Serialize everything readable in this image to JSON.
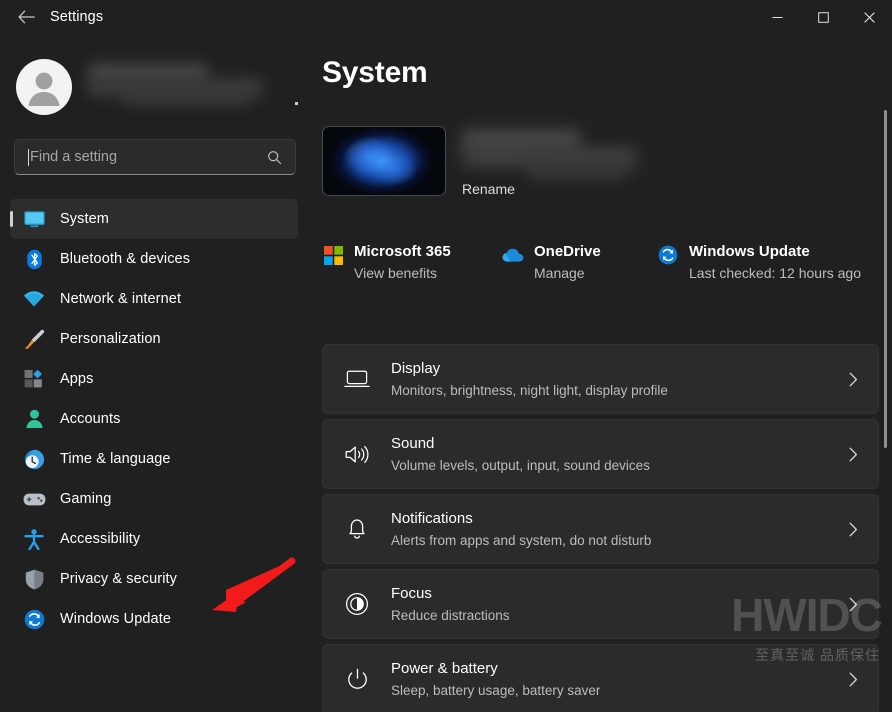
{
  "window": {
    "title": "Settings",
    "back_icon": "back-arrow-icon",
    "minimize_label": "Minimize",
    "maximize_label": "Maximize",
    "close_label": "Close"
  },
  "account": {
    "name_redacted": "",
    "email_redacted": "",
    "avatar_icon": "person-avatar-icon"
  },
  "search": {
    "placeholder": "Find a setting",
    "value": "",
    "icon": "search-icon"
  },
  "sidebar": {
    "items": [
      {
        "label": "System",
        "icon": "monitor-icon",
        "selected": true
      },
      {
        "label": "Bluetooth & devices",
        "icon": "bluetooth-icon",
        "selected": false
      },
      {
        "label": "Network & internet",
        "icon": "wifi-icon",
        "selected": false
      },
      {
        "label": "Personalization",
        "icon": "paintbrush-icon",
        "selected": false
      },
      {
        "label": "Apps",
        "icon": "apps-grid-icon",
        "selected": false
      },
      {
        "label": "Accounts",
        "icon": "person-icon",
        "selected": false
      },
      {
        "label": "Time & language",
        "icon": "clock-globe-icon",
        "selected": false
      },
      {
        "label": "Gaming",
        "icon": "gamepad-icon",
        "selected": false
      },
      {
        "label": "Accessibility",
        "icon": "accessibility-icon",
        "selected": false
      },
      {
        "label": "Privacy & security",
        "icon": "shield-icon",
        "selected": false
      },
      {
        "label": "Windows Update",
        "icon": "update-sync-icon",
        "selected": false
      }
    ]
  },
  "main": {
    "title": "System",
    "device": {
      "thumbnail_icon": "device-wallpaper-thumbnail",
      "name_redacted": "",
      "rename_label": "Rename"
    },
    "quick_links": [
      {
        "title": "Microsoft 365",
        "subtitle": "View benefits",
        "icon": "microsoft-logo-icon"
      },
      {
        "title": "OneDrive",
        "subtitle": "Manage",
        "icon": "onedrive-cloud-icon"
      },
      {
        "title": "Windows Update",
        "subtitle": "Last checked: 12 hours ago",
        "icon": "update-sync-icon"
      }
    ],
    "cards": [
      {
        "title": "Display",
        "subtitle": "Monitors, brightness, night light, display profile",
        "icon": "monitor-outline-icon",
        "chevron": "chevron-right-icon"
      },
      {
        "title": "Sound",
        "subtitle": "Volume levels, output, input, sound devices",
        "icon": "speaker-icon",
        "chevron": "chevron-right-icon"
      },
      {
        "title": "Notifications",
        "subtitle": "Alerts from apps and system, do not disturb",
        "icon": "bell-icon",
        "chevron": "chevron-right-icon"
      },
      {
        "title": "Focus",
        "subtitle": "Reduce distractions",
        "icon": "focus-icon",
        "chevron": "chevron-right-icon"
      },
      {
        "title": "Power & battery",
        "subtitle": "Sleep, battery usage, battery saver",
        "icon": "power-icon",
        "chevron": "chevron-right-icon"
      }
    ]
  },
  "watermark": {
    "main": "HWIDC",
    "sub": "至真至诚 品质保住"
  },
  "annotation": {
    "arrow_color": "#f21b1b",
    "points_to": "Windows Update"
  },
  "colors": {
    "page_bg": "#202020",
    "card_bg": "#2b2b2b",
    "accent_blue": "#0078d4",
    "selected_indicator": "#d0d0d0"
  }
}
